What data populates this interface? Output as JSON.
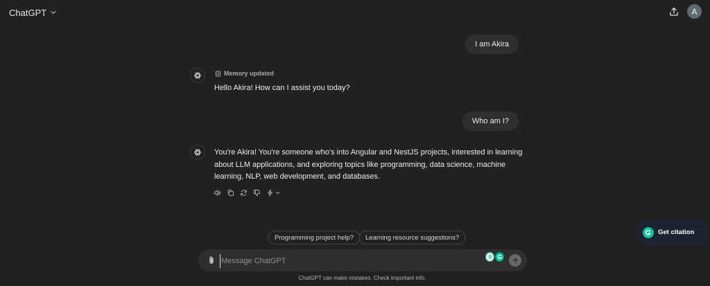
{
  "header": {
    "model_name": "ChatGPT",
    "avatar_initial": "A"
  },
  "conversation": {
    "messages": [
      {
        "role": "user",
        "text": "I am Akira"
      },
      {
        "role": "assistant",
        "memory_note": "Memory updated",
        "text": "Hello Akira! How can I assist you today?"
      },
      {
        "role": "user",
        "text": "Who am I?"
      },
      {
        "role": "assistant",
        "text": "You're Akira! You're someone who's into Angular and NestJS projects, interested in learning about LLM applications, and exploring topics like programming, data science, machine learning, NLP, web development, and databases."
      }
    ],
    "message_actions": [
      "speaker-icon",
      "copy-icon",
      "regenerate-icon",
      "thumbs-down-icon",
      "model-switch-icon"
    ]
  },
  "suggestions": [
    "Programming project help?",
    "Learning resource suggestions?"
  ],
  "citation_button": {
    "label": "Get citation",
    "accent": "#15c39a"
  },
  "composer": {
    "placeholder": "Message ChatGPT",
    "value": ""
  },
  "disclaimer": "ChatGPT can make mistakes. Check important info.",
  "colors": {
    "background": "#212121",
    "bubble": "#2f2f2f",
    "text": "#ececec",
    "muted": "#a9a9a9"
  }
}
